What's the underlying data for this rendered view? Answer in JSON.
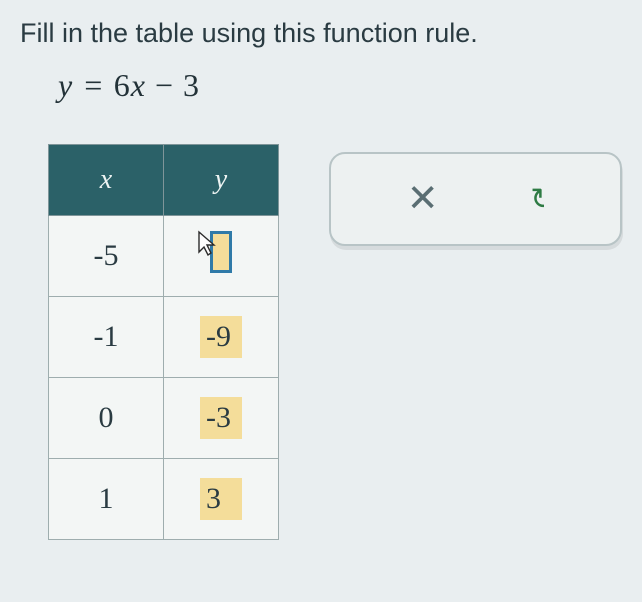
{
  "instruction": "Fill in the table using this function rule.",
  "formula_lhs": "y",
  "formula_rhs_a": "6",
  "formula_rhs_var": "x",
  "formula_rhs_b": "3",
  "table": {
    "headers": {
      "x": "x",
      "y": "y"
    },
    "rows": [
      {
        "x": "-5",
        "y": ""
      },
      {
        "x": "-1",
        "y": "-9"
      },
      {
        "x": "0",
        "y": "-3"
      },
      {
        "x": "1",
        "y": "3"
      }
    ]
  },
  "feedback": {
    "wrong_glyph": "✕",
    "redo_glyph": "↻"
  }
}
